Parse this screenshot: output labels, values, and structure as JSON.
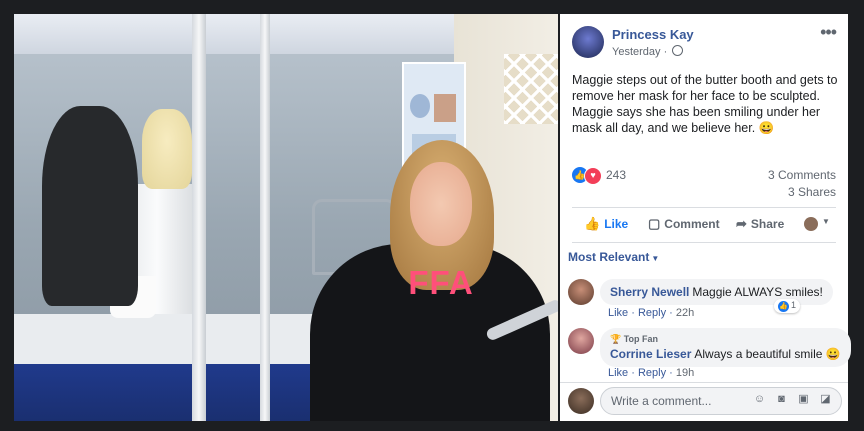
{
  "post": {
    "page_name": "Princess Kay",
    "timestamp": "Yesterday",
    "privacy_icon": "globe-icon",
    "text": "Maggie steps out of the butter booth and gets to remove her mask for her face to be sculpted. Maggie says she has been smiling under her mask all day, and we believe her.",
    "emoji": "😀",
    "photo_sweatshirt_text": "FFA",
    "reactions": {
      "icons": [
        "like",
        "love"
      ],
      "count": "243"
    },
    "comments_count": "3 Comments",
    "shares_count": "3 Shares"
  },
  "actions": {
    "like": "Like",
    "comment": "Comment",
    "share": "Share"
  },
  "comments_filter": "Most Relevant",
  "comments": [
    {
      "badge": "",
      "name": "Sherry Newell",
      "text": "Maggie ALWAYS smiles!",
      "emoji": "",
      "like": "Like",
      "reply": "Reply",
      "time": "22h",
      "reaction_count": "1"
    },
    {
      "badge": "Top Fan",
      "name": "Corrine Lieser",
      "text": "Always a beautiful smile",
      "emoji": "😀",
      "like": "Like",
      "reply": "Reply",
      "time": "19h",
      "reaction_count": ""
    }
  ],
  "composer": {
    "placeholder": "Write a comment...",
    "icons": [
      "emoji-icon",
      "camera-icon",
      "gif-icon",
      "sticker-icon"
    ]
  },
  "colors": {
    "link": "#385898",
    "like_blue": "#1877f2",
    "love_red": "#f33e58",
    "ffa_pink": "#ff4f7a"
  }
}
